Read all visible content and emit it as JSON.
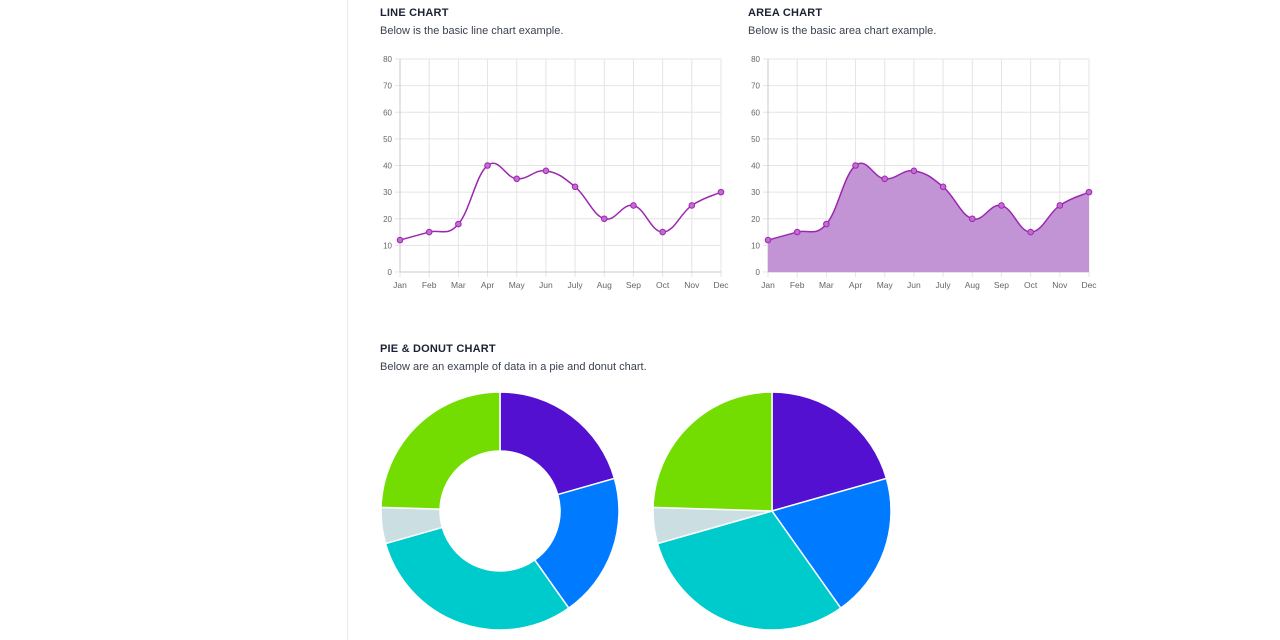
{
  "line_section": {
    "title": "LINE CHART",
    "description": "Below is the basic line chart example."
  },
  "area_section": {
    "title": "AREA CHART",
    "description": "Below is the basic area chart example."
  },
  "pie_section": {
    "title": "PIE & DONUT CHART",
    "description": "Below are an example of data in a pie and donut chart."
  },
  "colors": {
    "line": "#9c27b0",
    "area_fill": "#c394d5",
    "grid": "#e4e4e4",
    "axis": "#c8c8c8",
    "tick_text": "#666666",
    "pie": [
      "#5410d0",
      "#007bff",
      "#00cbcc",
      "#cbdfe3",
      "#73dc00"
    ]
  },
  "chart_data": [
    {
      "type": "line",
      "categories": [
        "Jan",
        "Feb",
        "Mar",
        "Apr",
        "May",
        "Jun",
        "July",
        "Aug",
        "Sep",
        "Oct",
        "Nov",
        "Dec"
      ],
      "values": [
        12,
        15,
        18,
        40,
        35,
        38,
        32,
        20,
        25,
        15,
        25,
        30
      ],
      "ylim": [
        0,
        80
      ],
      "yticks": [
        0,
        10,
        20,
        30,
        40,
        50,
        60,
        70,
        80
      ],
      "grid": true,
      "smooth": true
    },
    {
      "type": "area",
      "categories": [
        "Jan",
        "Feb",
        "Mar",
        "Apr",
        "May",
        "Jun",
        "July",
        "Aug",
        "Sep",
        "Oct",
        "Nov",
        "Dec"
      ],
      "values": [
        12,
        15,
        18,
        40,
        35,
        38,
        32,
        20,
        25,
        15,
        25,
        30
      ],
      "ylim": [
        0,
        80
      ],
      "yticks": [
        0,
        10,
        20,
        30,
        40,
        50,
        60,
        70,
        80
      ],
      "grid": true,
      "smooth": true
    },
    {
      "type": "pie",
      "variant": "donut",
      "values": [
        21,
        20,
        31,
        5,
        25
      ]
    },
    {
      "type": "pie",
      "variant": "pie",
      "values": [
        21,
        20,
        31,
        5,
        25
      ]
    }
  ]
}
